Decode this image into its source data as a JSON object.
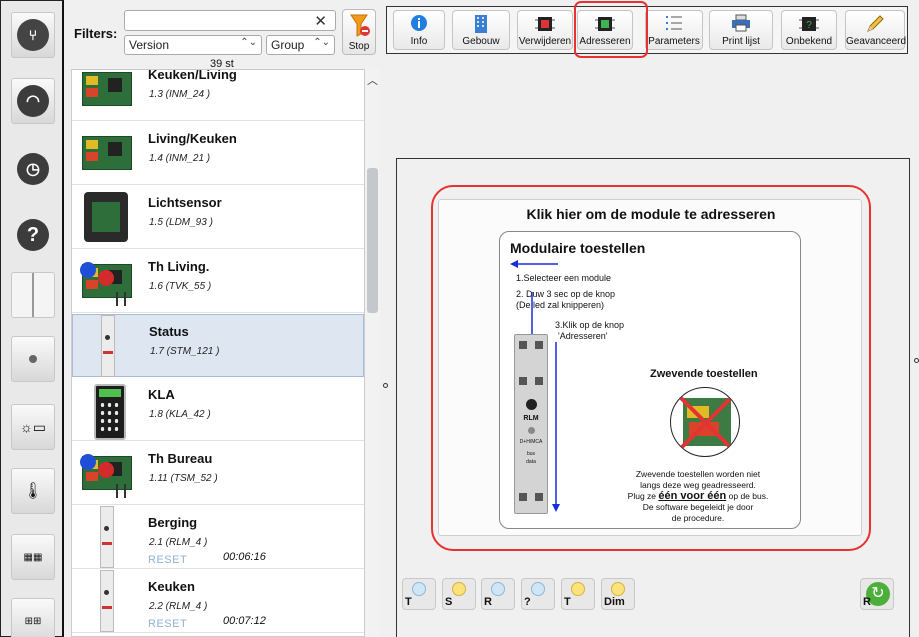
{
  "filters": {
    "label": "Filters:",
    "search_value": "",
    "version_select": "Version",
    "group_select": "Group",
    "stop_label": "Stop",
    "count": "39 st"
  },
  "rail": {
    "items": [
      "modules-icon",
      "gauge-icon",
      "clock-icon",
      "question-icon",
      "switch-icon",
      "push-button-icon",
      "sensor-display-icon",
      "thermostat-icon",
      "keypad-icon",
      "numpad-icon"
    ]
  },
  "devices": [
    {
      "name": "Keuken/Living",
      "addr": "1.3 (INM_24 )",
      "type": "board"
    },
    {
      "name": "Living/Keuken",
      "addr": "1.4 (INM_21 )",
      "type": "board"
    },
    {
      "name": "Lichtsensor",
      "addr": "1.5 (LDM_93 )",
      "type": "box"
    },
    {
      "name": "Th Living.",
      "addr": "1.6 (TVK_55 )",
      "type": "thermo"
    },
    {
      "name": "Status",
      "addr": "1.7 (STM_121 )",
      "type": "din",
      "selected": true
    },
    {
      "name": "KLA",
      "addr": "1.8 (KLA_42 )",
      "type": "keypad"
    },
    {
      "name": "Th Bureau",
      "addr": "1.11 (TSM_52 )",
      "type": "thermo"
    },
    {
      "name": "Berging",
      "addr": "2.1 (RLM_4 )",
      "type": "din",
      "reset": "RESET",
      "time": "00:06:16"
    },
    {
      "name": "Keuken",
      "addr": "2.2 (RLM_4 )",
      "type": "din",
      "reset": "RESET",
      "time": "00:07:12"
    }
  ],
  "toolbar": {
    "buttons": [
      {
        "label": "Info",
        "icon": "info-icon"
      },
      {
        "label": "Gebouw",
        "icon": "building-icon"
      },
      {
        "label": "Verwijderen",
        "icon": "chip-remove-icon"
      },
      {
        "label": "Adresseren",
        "icon": "chip-address-icon",
        "highlighted": true
      },
      {
        "label": "Parameters",
        "icon": "list-icon"
      },
      {
        "label": "Print lijst",
        "icon": "printer-icon"
      },
      {
        "label": "Onbekend",
        "icon": "chip-unknown-icon"
      },
      {
        "label": "Geavanceerd",
        "icon": "pencil-icon"
      }
    ]
  },
  "panel": {
    "title": "Klik hier om de module te adresseren",
    "modular_title": "Modulaire toestellen",
    "step1": "1.Selecteer een module",
    "step2a": "2. Duw 3 sec op de knop",
    "step2b": "(De led zal knipperen)",
    "step3a": "3.Klik op de knop",
    "step3b": "'Adresseren'",
    "floating_title": "Zwevende toestellen",
    "floating_line1": "Zwevende toestellen worden niet",
    "floating_line2": "langs deze weg geadresseerd.",
    "floating_line3a": "Plug ze",
    "floating_line3b": "één voor één",
    "floating_line3c": "op de bus.",
    "floating_line4": "De software begeleidt je door",
    "floating_line5": "de procedure.",
    "rlm_label": "RLM",
    "din_brand": "D+H/MCA",
    "din_bus": "bus",
    "din_data": "data"
  },
  "bottom_buttons": [
    {
      "label": "T",
      "on": false
    },
    {
      "label": "S",
      "on": true
    },
    {
      "label": "R",
      "on": false
    },
    {
      "label": "?",
      "on": false
    },
    {
      "label": "T",
      "on": true
    },
    {
      "label": "Dim",
      "on": true
    }
  ],
  "refresh_label": "R",
  "colors": {
    "highlight": "#e53232",
    "selected_row": "#dde6f1",
    "reset_text": "#8fb2d8"
  }
}
